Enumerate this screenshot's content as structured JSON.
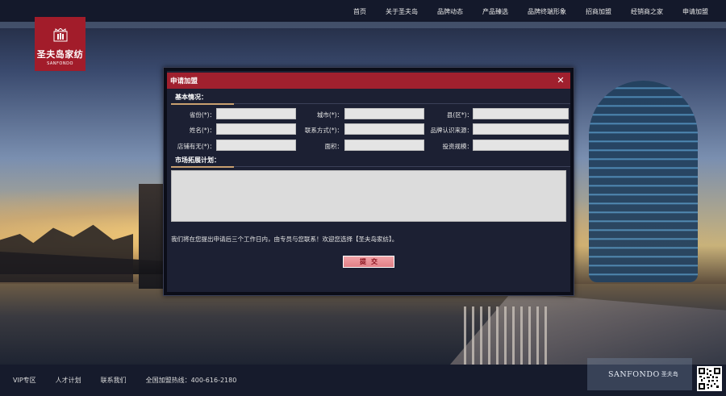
{
  "brand": {
    "logo_cn": "圣夫岛家纺",
    "logo_en": "SANFONDO",
    "color_primary": "#a21c2a"
  },
  "nav": {
    "items": [
      {
        "label": "首页"
      },
      {
        "label": "关于圣夫岛"
      },
      {
        "label": "品牌动态"
      },
      {
        "label": "产品臻选"
      },
      {
        "label": "品牌终端形象"
      },
      {
        "label": "招商加盟"
      },
      {
        "label": "经销商之家"
      },
      {
        "label": "申请加盟"
      }
    ]
  },
  "modal": {
    "title": "申请加盟",
    "close_icon": "close-icon",
    "basic_section": "基本情况：",
    "fields": {
      "province": {
        "label": "省份(*)：",
        "value": ""
      },
      "city": {
        "label": "城市(*)：",
        "value": ""
      },
      "county": {
        "label": "县(区*)：",
        "value": ""
      },
      "name": {
        "label": "姓名(*)：",
        "value": ""
      },
      "contact": {
        "label": "联系方式(*)：",
        "value": ""
      },
      "source": {
        "label": "品牌认识来源：",
        "value": ""
      },
      "store": {
        "label": "店铺有无(*)：",
        "value": ""
      },
      "area": {
        "label": "面积：",
        "value": ""
      },
      "scale": {
        "label": "投资规模：",
        "value": ""
      }
    },
    "plan_section": "市场拓展计划：",
    "plan_value": "",
    "notice": "我们将在您提出申请后三个工作日内，由专员与您联系！欢迎您选择【圣夫岛家纺】。",
    "submit_label": "提交"
  },
  "footer": {
    "links": [
      {
        "label": "VIP专区"
      },
      {
        "label": "人才计划"
      },
      {
        "label": "联系我们"
      }
    ],
    "hotline": "全国加盟热线：400-616-2180",
    "brand_en": "SANFONDO",
    "brand_cn": "圣夫岛"
  }
}
